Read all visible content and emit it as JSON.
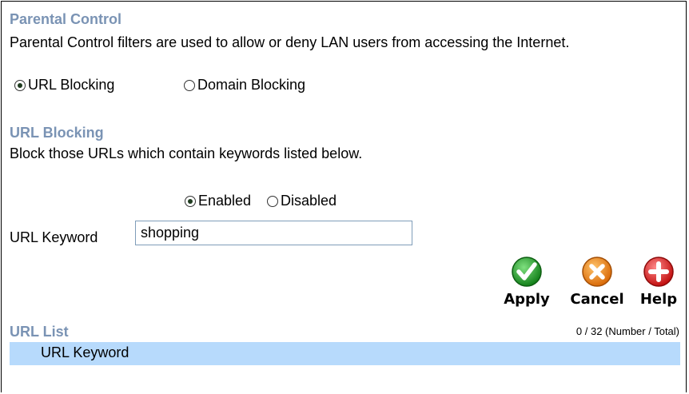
{
  "parental": {
    "title": "Parental Control",
    "description": "Parental Control filters are used to allow or deny LAN users from accessing the Internet.",
    "mode_options": [
      {
        "label": "URL Blocking",
        "checked": true
      },
      {
        "label": "Domain Blocking",
        "checked": false
      }
    ]
  },
  "url_blocking": {
    "title": "URL Blocking",
    "description": "Block those URLs which contain keywords listed below.",
    "enabled_label": "Enabled",
    "disabled_label": "Disabled",
    "enabled": true,
    "keyword_label": "URL Keyword",
    "keyword_value": "shopping"
  },
  "buttons": {
    "apply": "Apply",
    "cancel": "Cancel",
    "help": "Help"
  },
  "url_list": {
    "title": "URL List",
    "count": "0 / 32 (Number / Total)",
    "column_header": "URL Keyword"
  },
  "colors": {
    "section_title": "#7a93b4",
    "list_header_bg": "#b7dafc",
    "apply_green": "#1f9a1f",
    "cancel_orange": "#f08a1c",
    "help_red": "#e01e1e"
  },
  "icons": {
    "apply": "checkmark-icon",
    "cancel": "x-icon",
    "help": "plus-icon"
  }
}
